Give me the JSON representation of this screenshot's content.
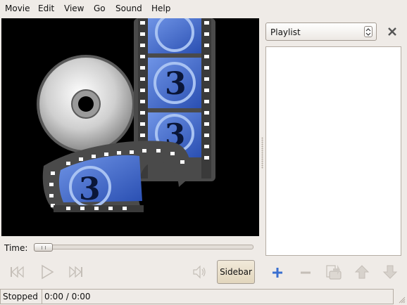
{
  "menubar": {
    "items": [
      "Movie",
      "Edit",
      "View",
      "Go",
      "Sound",
      "Help"
    ]
  },
  "video": {
    "logo_number": "3"
  },
  "seek": {
    "label": "Time:",
    "position": 0.0
  },
  "controls": {
    "sidebar_label": "Sidebar"
  },
  "sidebar": {
    "selector_value": "Playlist"
  },
  "status": {
    "state": "Stopped",
    "time": "0:00 / 0:00"
  },
  "icons": {
    "previous": "skip-previous-icon",
    "play": "play-icon",
    "next": "skip-next-icon",
    "volume": "volume-icon",
    "add": "add-icon",
    "remove": "remove-icon",
    "save": "save-playlist-icon",
    "up": "move-up-icon",
    "down": "move-down-icon",
    "close": "close-icon"
  },
  "colors": {
    "window_bg": "#efebe7",
    "video_bg": "#000000",
    "film_blue": "#3a62c8",
    "add_icon_blue": "#3a6fd0"
  }
}
